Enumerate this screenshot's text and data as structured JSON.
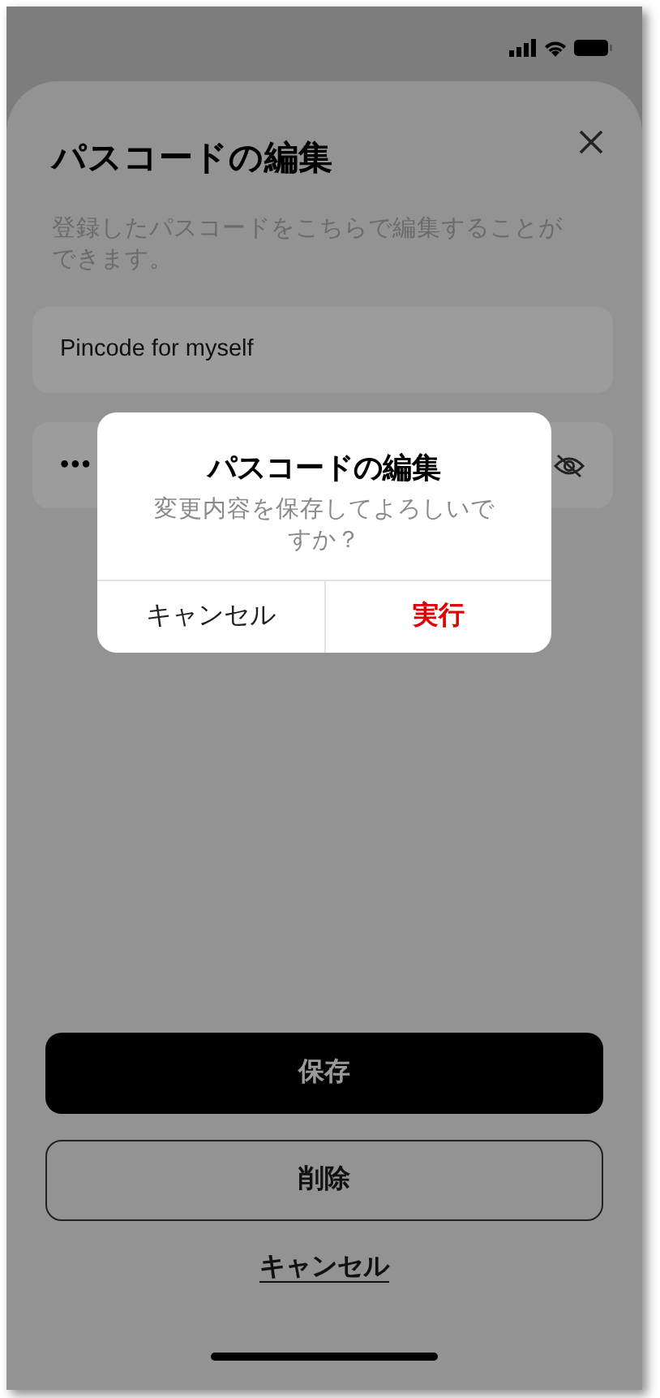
{
  "sheet": {
    "title": "パスコードの編集",
    "description": "登録したパスコードをこちらで編集することができます。",
    "fields": [
      {
        "kind": "text",
        "value": "Pincode for myself"
      },
      {
        "kind": "password",
        "value": "•••"
      }
    ],
    "buttons": [
      {
        "kind": "primary",
        "label": "保存"
      },
      {
        "kind": "outline",
        "label": "削除"
      },
      {
        "kind": "link",
        "label": "キャンセル"
      }
    ]
  },
  "dialog": {
    "title": "パスコードの編集",
    "message": "変更内容を保存してよろしいですか？",
    "buttons": [
      {
        "kind": "default",
        "label": "キャンセル"
      },
      {
        "kind": "destructive",
        "label": "実行"
      }
    ]
  }
}
